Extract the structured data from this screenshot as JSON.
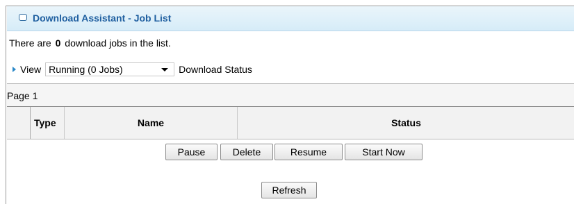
{
  "panel": {
    "title": "Download Assistant - Job List"
  },
  "summary": {
    "prefix": "There are",
    "count": "0",
    "suffix": "download jobs in the list."
  },
  "view": {
    "label": "View",
    "selected": "Running (0 Jobs)",
    "trailing_label": "Download Status"
  },
  "pagination": {
    "label": "Page 1"
  },
  "table": {
    "columns": [
      "Type",
      "Name",
      "Status"
    ],
    "rows": []
  },
  "actions": {
    "pause": "Pause",
    "delete": "Delete",
    "resume": "Resume",
    "start_now": "Start Now",
    "refresh": "Refresh"
  },
  "colors": {
    "title_text": "#1f5fa0",
    "title_bg": "#d6ecf8",
    "accent_triangle": "#2a88c8"
  }
}
